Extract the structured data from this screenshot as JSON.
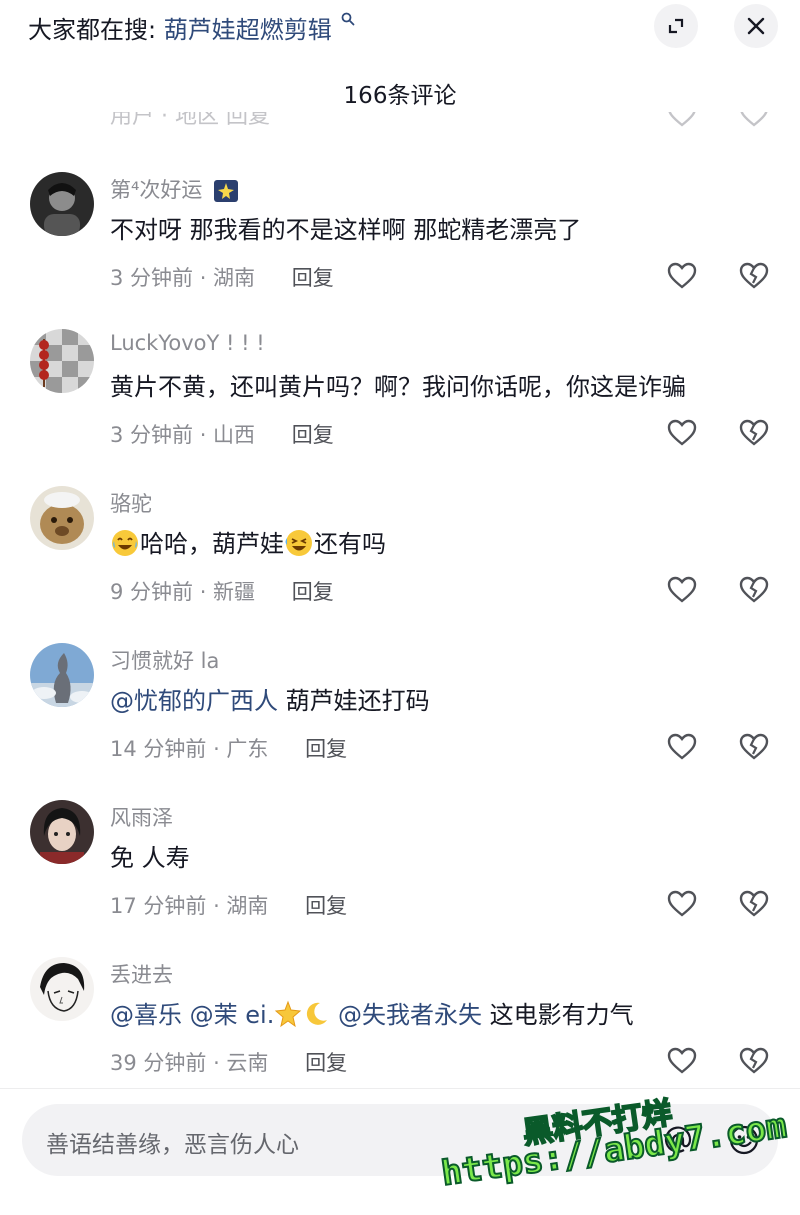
{
  "header": {
    "search_prefix": "大家都在搜:",
    "search_keyword": "葫芦娃超燃剪辑",
    "comment_count_title": "166条评论"
  },
  "clipped_row_text": "用户 · 地区  回复",
  "comments": [
    {
      "username": "第⁴次好运",
      "content": "不对呀 那我看的不是这样啊   那蛇精老漂亮了",
      "time_location": "3 分钟前 · 湖南",
      "reply": "回复"
    },
    {
      "username": "LuckYovoY ! ! !",
      "content": "黄片不黄，还叫黄片吗？啊？我问你话呢，你这是诈骗",
      "time_location": "3 分钟前 · 山西",
      "reply": "回复"
    },
    {
      "username": "骆驼",
      "content_a": "哈哈，葫芦娃",
      "content_b": "还有吗",
      "time_location": "9 分钟前 · 新疆",
      "reply": "回复"
    },
    {
      "username": "习惯就好 la",
      "mention": "@忧郁的广西人",
      "content": " 葫芦娃还打码",
      "time_location": "14 分钟前 · 广东",
      "reply": "回复"
    },
    {
      "username": "风雨泽",
      "content": "免 人寿",
      "time_location": "17 分钟前 · 湖南",
      "reply": "回复"
    },
    {
      "username": "丢进去",
      "mention_1": "@喜乐",
      "mention_2": "@茉 ei.",
      "mention_3": "@失我者永失",
      "content": " 这电影有力气",
      "time_location": "39 分钟前 · 云南",
      "reply": "回复"
    }
  ],
  "input": {
    "placeholder": "善语结善缘，恶言伤人心"
  },
  "watermark": {
    "line1": "黑料不打烊",
    "line2": "https://abdy7.com"
  },
  "colors": {
    "accent_link": "#2f4a7a",
    "text_primary": "#161823",
    "text_secondary": "#8a8b91"
  }
}
